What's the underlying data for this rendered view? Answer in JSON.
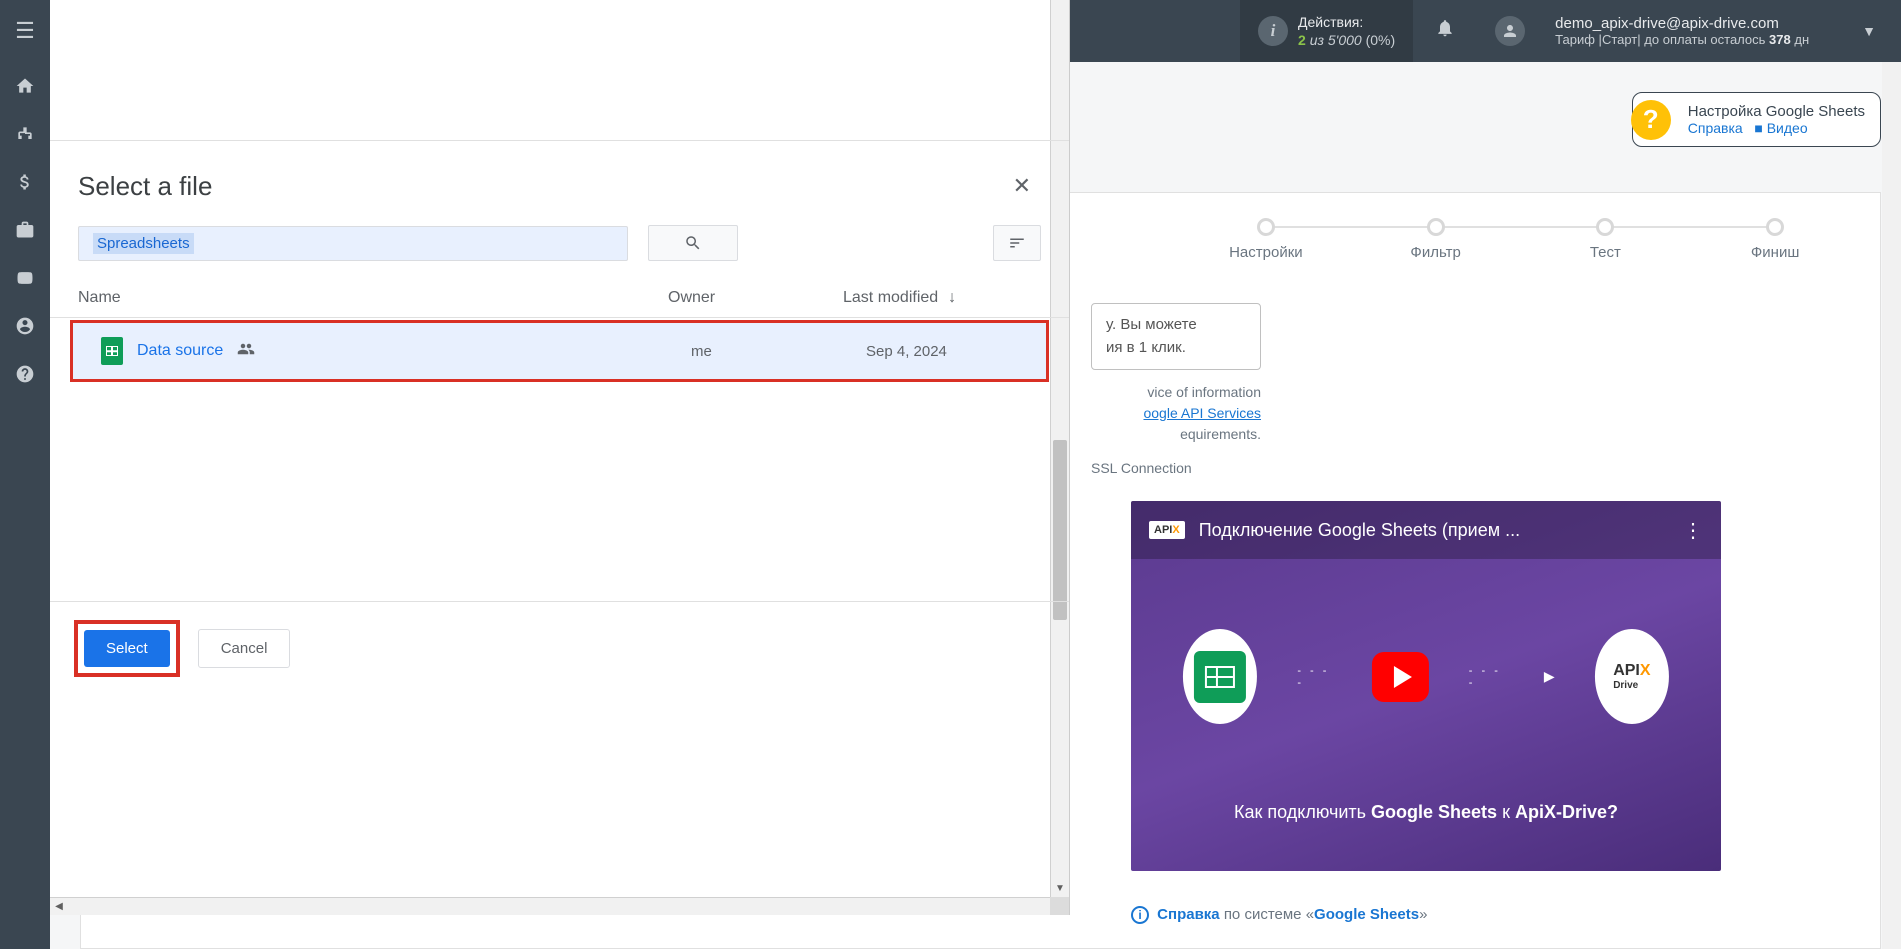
{
  "header": {
    "actions_label": "Действия:",
    "actions_count": "2",
    "actions_of": "из",
    "actions_total": "5'000",
    "actions_pct": "(0%)",
    "user_email": "demo_apix-drive@apix-drive.com",
    "tariff_prefix": "Тариф |",
    "tariff_name": "Старт",
    "tariff_sep": "|",
    "tariff_pay": "до оплаты осталось",
    "tariff_days": "378",
    "tariff_days_unit": "дн"
  },
  "helpbox": {
    "title": "Настройка Google Sheets",
    "link_help": "Справка",
    "link_video": "Видео"
  },
  "steps": {
    "s1": "Настройки",
    "s2": "Фильтр",
    "s3": "Тест",
    "s4": "Финиш"
  },
  "hints": {
    "peek1": "у. Вы можете",
    "peek2": "ия в 1 клик.",
    "peek3": "vice of information",
    "peek4": "oogle API Services",
    "peek5": "equirements.",
    "ssl": "SSL Connection"
  },
  "video": {
    "logo": "APIX-Drive",
    "title": "Подключение Google Sheets (прием ...",
    "caption_pre": "Как подключить",
    "caption_bold": "Google Sheets",
    "caption_mid": "к",
    "caption_end": "ApiX-Drive?"
  },
  "spravka": {
    "label": "Справка",
    "mid": "по системе «",
    "system": "Google Sheets",
    "end": "»"
  },
  "modal": {
    "title": "Select a file",
    "chip": "Spreadsheets",
    "col_name": "Name",
    "col_owner": "Owner",
    "col_modified": "Last modified",
    "file_name": "Data source",
    "file_owner": "me",
    "file_date": "Sep 4, 2024",
    "btn_select": "Select",
    "btn_cancel": "Cancel"
  }
}
